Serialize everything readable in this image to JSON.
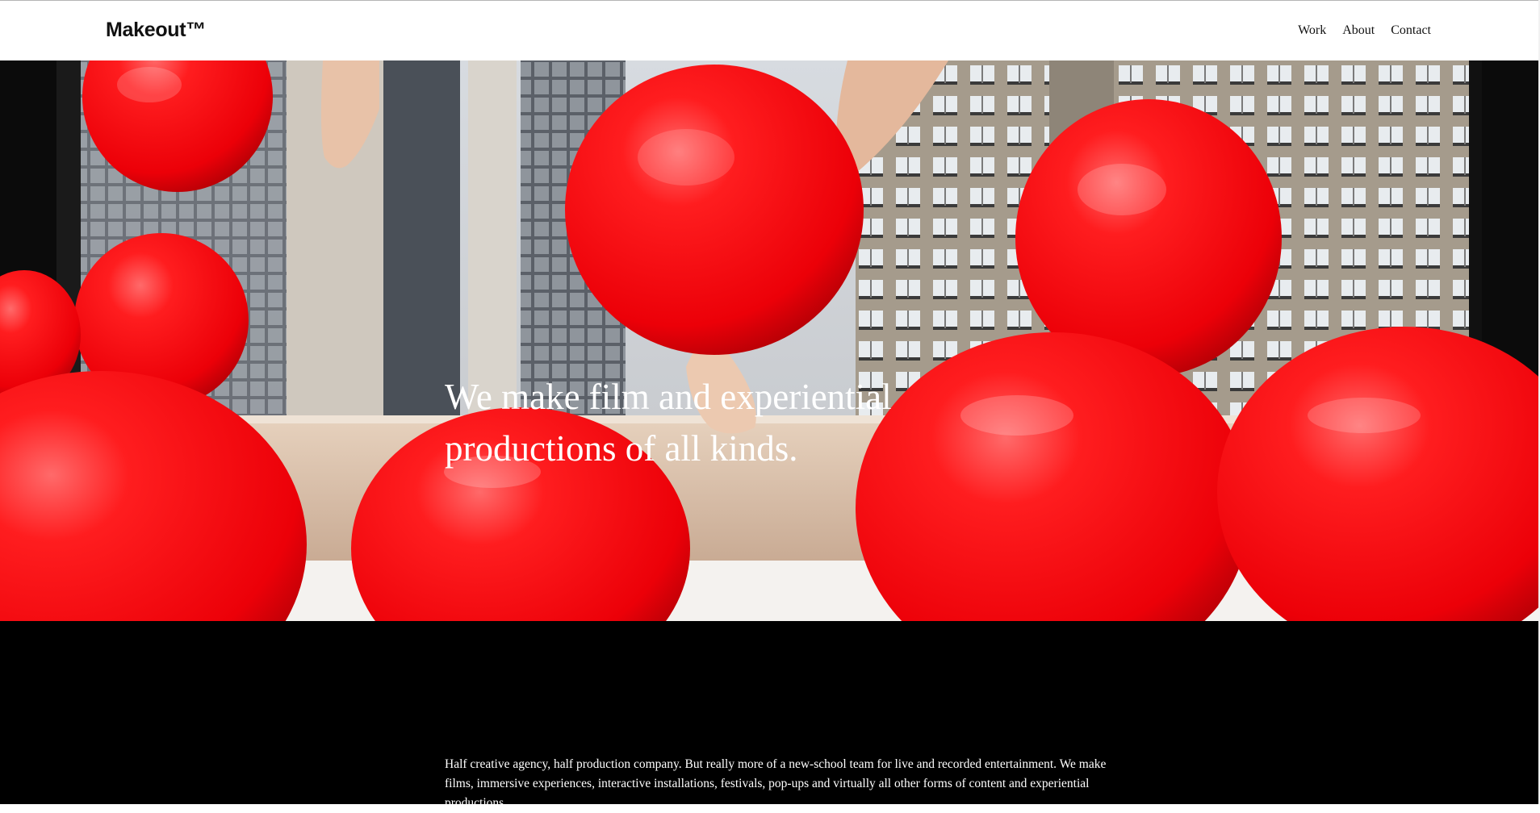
{
  "header": {
    "logo": "Makeout™",
    "nav": [
      "Work",
      "About",
      "Contact"
    ]
  },
  "hero": {
    "title_line1": "We make film and experiential",
    "title_line2": "productions of all kinds."
  },
  "intro": {
    "text": "Half creative agency, half production company. But really more of a new-school team for live and recorded entertainment. We make films, immersive experiences, interactive installations, festivals, pop-ups and virtually all other forms of content and experiential productions."
  },
  "colors": {
    "balloon": "#f20a0f",
    "sill": "#dbc3ac",
    "text_dark": "#111111",
    "section_bg": "#000000"
  }
}
